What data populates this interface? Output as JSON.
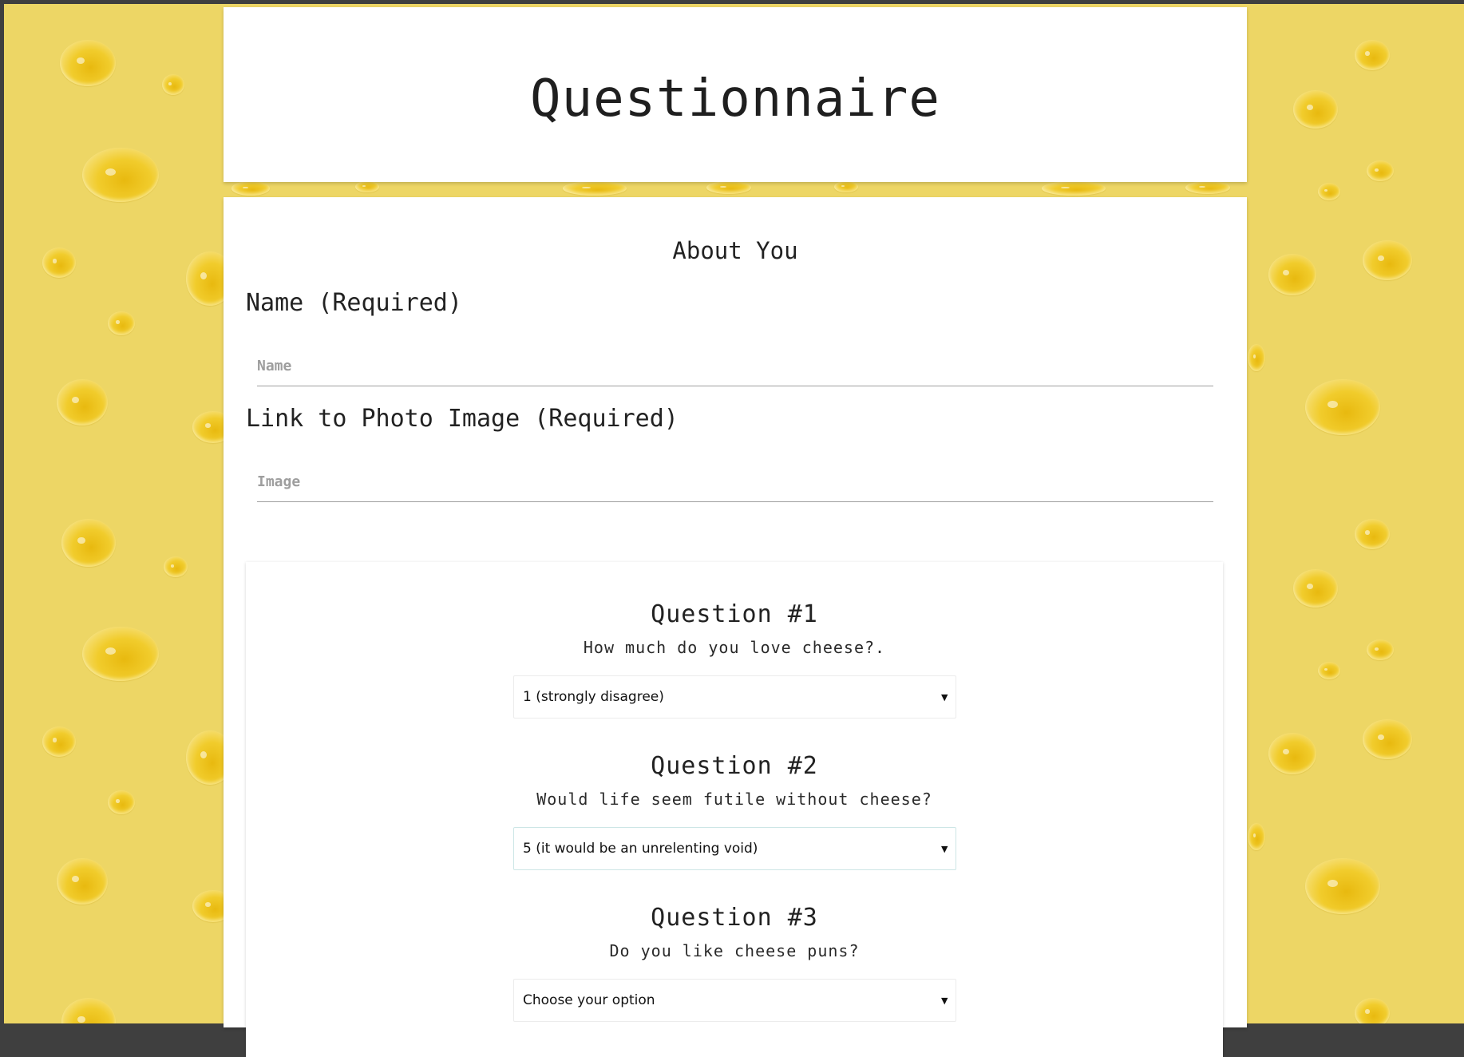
{
  "header": {
    "title": "Questionnaire"
  },
  "about": {
    "section_title": "About You",
    "name_label": "Name (Required)",
    "name_placeholder": "Name",
    "image_label": "Link to Photo Image (Required)",
    "image_placeholder": "Image"
  },
  "questions": [
    {
      "title": "Question #1",
      "text": "How much do you love cheese?.",
      "selected": "1 (strongly disagree)"
    },
    {
      "title": "Question #2",
      "text": "Would life seem futile without cheese?",
      "selected": "5 (it would be an unrelenting void)"
    },
    {
      "title": "Question #3",
      "text": "Do you like cheese puns?",
      "selected": "Choose your option"
    }
  ],
  "icons": {
    "dropdown": "caret-down-icon"
  },
  "colors": {
    "background": "#edd665",
    "card": "#ffffff",
    "text": "#222222"
  }
}
